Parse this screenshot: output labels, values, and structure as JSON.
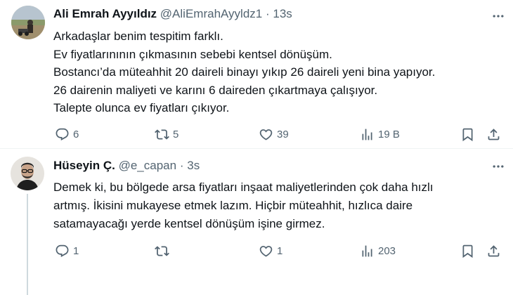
{
  "tweets": [
    {
      "author": "Ali Emrah Ayyıldız",
      "handle": "@AliEmrahAyyldz1",
      "separator": "·",
      "time": "13s",
      "lines": [
        "Arkadaşlar benim tespitim farklı.",
        "Ev fiyatlarınının çıkmasının sebebi kentsel dönüşüm.",
        "Bostancı’da müteahhit 20 daireli binayı yıkıp 26 daireli yeni bina yapıyor.",
        "26 dairenin maliyeti ve karını 6 daireden çıkartmaya çalışıyor.",
        "Talepte olunca ev fiyatları çıkıyor."
      ],
      "stats": {
        "replies": "6",
        "reposts": "5",
        "likes": "39",
        "views": "19 B"
      },
      "icons": [
        "reply-icon",
        "repost-icon",
        "like-icon",
        "views-icon",
        "bookmark-icon",
        "share-icon",
        "more-icon"
      ]
    },
    {
      "author": "Hüseyin Ç.",
      "handle": "@e_capan",
      "separator": "·",
      "time": "3s",
      "lines": [
        "Demek ki, bu bölgede arsa fiyatları inşaat maliyetlerinden çok daha hızlı",
        "artmış. İkisini mukayese etmek lazım. Hiçbir müteahhit, hızlıca daire",
        "satamayacağı yerde kentsel dönüşüm işine girmez."
      ],
      "stats": {
        "replies": "1",
        "reposts": "",
        "likes": "1",
        "views": "203"
      },
      "icons": [
        "reply-icon",
        "repost-icon",
        "like-icon",
        "views-icon",
        "bookmark-icon",
        "share-icon",
        "more-icon"
      ]
    }
  ],
  "colors": {
    "text": "#0f1419",
    "secondary": "#536471",
    "border": "#eff3f4",
    "thread": "#cfd9de"
  }
}
